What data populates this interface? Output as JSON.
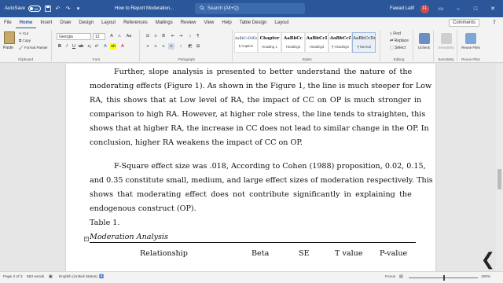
{
  "titlebar": {
    "autosave_label": "AutoSave",
    "autosave_state": "Off",
    "doc_title": "How to Report Moderation...",
    "search_placeholder": "Search (Alt+Q)",
    "user_name": "Fawad Latif",
    "user_initials": "FL",
    "accent_color": "#2b579a"
  },
  "menu": {
    "tabs": [
      "File",
      "Home",
      "Insert",
      "Draw",
      "Design",
      "Layout",
      "References",
      "Mailings",
      "Review",
      "View",
      "Help",
      "Table Design",
      "Layout"
    ],
    "active_tab": "Home",
    "comments_label": "Comments"
  },
  "ribbon": {
    "clipboard": {
      "paste": "Paste",
      "cut": "Cut",
      "copy": "Copy",
      "format_painter": "Format Painter",
      "label": "Clipboard"
    },
    "font": {
      "name": "Georgia",
      "size": "12",
      "label": "Font"
    },
    "paragraph": {
      "label": "Paragraph"
    },
    "styles": {
      "items": [
        {
          "sample": "AaBbCcDdEe",
          "name": "¶ Caption"
        },
        {
          "sample": "Chapter",
          "name": "Heading 1"
        },
        {
          "sample": "AaBbCc",
          "name": "Heading2"
        },
        {
          "sample": "AaBbCcI",
          "name": "Heading3"
        },
        {
          "sample": "AaBbCcI",
          "name": "¶ Heading4"
        },
        {
          "sample": "AaBbCcDd",
          "name": "¶ Normal"
        }
      ],
      "label": "Styles"
    },
    "editing": {
      "find": "Find",
      "replace": "Replace",
      "select": "Select",
      "label": "Editing"
    },
    "ucheck": {
      "name": "Ucheck"
    },
    "sensitivity": {
      "name": "Sensitivity",
      "label": "Sensitivity"
    },
    "reuse": {
      "name": "Reuse Files",
      "label": "Reuse Files"
    }
  },
  "document": {
    "para1": [
      "Further, slope analysis is presented to better understand the nature of the",
      "moderating effects (Figure 1). As shown in the Figure 1, the line is much steeper for Low",
      "RA, this shows that at Low level of RA, the impact of CC on OP is much stronger in",
      "comparison to high RA. However, at higher role stress, the line tends to straighten, this",
      "shows that at higher RA, the increase in CC does not lead to similar change in the OP. In",
      "conclusion, higher RA weakens the impact of CC on OP."
    ],
    "para2": [
      "F-Square effect size was .018, According to Cohen (1988) proposition, 0.02, 0.15,",
      "and 0.35 constitute small, medium, and large effect sizes of moderation respectively. This",
      "shows that moderating effect does not contribute significantly in explaining the",
      "endogenous construct (OP)."
    ],
    "table_label": "Table 1.",
    "table_caption": "Moderation Analysis",
    "table_headers": [
      "Relationship",
      "Beta",
      "SE",
      "T value",
      "P-value"
    ]
  },
  "status": {
    "page": "Page 2 of 3",
    "words": "583 words",
    "language": "English (United States)",
    "focus": "Focus",
    "zoom": "100%"
  }
}
